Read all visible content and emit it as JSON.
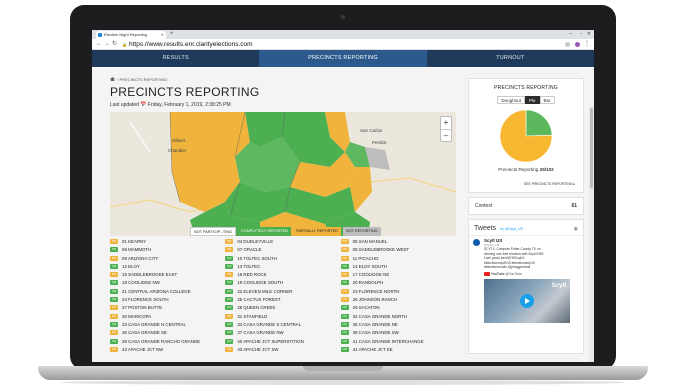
{
  "browser": {
    "tab_title": "Election Night Reporting",
    "url": "https://www.results.enr.clarityelections.com"
  },
  "nav": {
    "tabs": [
      {
        "label": "RESULTS"
      },
      {
        "label": "PRECINCTS REPORTING"
      },
      {
        "label": "TURNOUT"
      }
    ]
  },
  "breadcrumb": {
    "label": "PRECINCTS REPORTING"
  },
  "page": {
    "title": "PRECINCTS REPORTING",
    "updated": "Last updated 📅 Friday, February 1, 2019, 2:38:25 PM"
  },
  "map": {
    "place_labels": [
      "Gilbert",
      "Chandler",
      "San Carlos",
      "Peridot"
    ],
    "legend": [
      {
        "label": "NOT PARTICIP...TING",
        "color": "#ffffff"
      },
      {
        "label": "COMPLETELY REPORTED",
        "color": "#4caf50"
      },
      {
        "label": "PARTIALLY REPORTED",
        "color": "#f0b43c"
      },
      {
        "label": "NOT REPORTING",
        "color": "#bdbdbd"
      }
    ]
  },
  "precincts": [
    [
      "01 KEARNY",
      "04 DUDLEYVILLE",
      "05 SAN MANUEL"
    ],
    [
      "06 MAMMOTH",
      "07 ORACLE",
      "08 SADDLEBROOKE WEST"
    ],
    [
      "09 ARIZONA CITY",
      "10 TOLTEC SOUTH",
      "11 PICACHO"
    ],
    [
      "12 ELOY",
      "13 TOLTEC",
      "14 ELOY SOUTH"
    ],
    [
      "15 SADDLEBROOKE EAST",
      "16 RED ROCK",
      "17 COOLIDGE NE"
    ],
    [
      "18 COOLIDGE NW",
      "19 COOLIDGE SOUTH",
      "20 RANDOLPH"
    ],
    [
      "21 CENTRAL ARIZONA COLLEGE",
      "22 ELEVEN MILE CORNER",
      "23 FLORENCE NORTH"
    ],
    [
      "24 FLORENCE SOUTH",
      "25 CACTUS FOREST",
      "26 JOHNSON RANCH"
    ],
    [
      "27 POSTON BUTTE",
      "28 QUEEN CREEK",
      "29 SACATON"
    ],
    [
      "30 MARICOPA",
      "31 STANFIELD",
      "32 CASA GRANDE NORTH"
    ],
    [
      "33 CASA GRANDE N CENTRAL",
      "34 CASA GRANDE S CENTRAL",
      "35 CASA GRANDE NE"
    ],
    [
      "36 CASA GRANDE SE",
      "37 CASA GRANDE NW",
      "38 CASA GRANDE SW"
    ],
    [
      "39 CASA GRANDE RANCHO GRANDE",
      "40 APACHE JCT SUPERSTITION",
      "41 CASA GRANDE INTERCHANGE"
    ],
    [
      "42 APACHE JCT NW",
      "43 APACHE JCT SW",
      "44 APACHE JCT SE"
    ]
  ],
  "precinct_status": [
    [
      "partial",
      "partial",
      "partial"
    ],
    [
      "complete",
      "partial",
      "partial"
    ],
    [
      "partial",
      "complete",
      "partial"
    ],
    [
      "complete",
      "complete",
      "complete"
    ],
    [
      "partial",
      "partial",
      "partial"
    ],
    [
      "complete",
      "complete",
      "complete"
    ],
    [
      "complete",
      "complete",
      "partial"
    ],
    [
      "complete",
      "complete",
      "partial"
    ],
    [
      "partial",
      "complete",
      "complete"
    ],
    [
      "partial",
      "partial",
      "complete"
    ],
    [
      "complete",
      "complete",
      "complete"
    ],
    [
      "partial",
      "complete",
      "complete"
    ],
    [
      "complete",
      "complete",
      "complete"
    ],
    [
      "partial",
      "partial",
      "complete"
    ]
  ],
  "sidebar": {
    "title": "PRECINCTS REPORTING",
    "chart_toggle": [
      "Doughnut",
      "Pie",
      "Bar"
    ],
    "active_toggle": "Pie",
    "caption_prefix": "Precincts Reporting",
    "caption_value": "25/102",
    "toc_link": "SEE PRECINCTS REPORTING ▸",
    "contest_label": "Contest",
    "contest_value": "61"
  },
  "chart_data": {
    "type": "pie",
    "categories": [
      "Reporting",
      "Not reporting"
    ],
    "values": [
      25,
      77
    ],
    "colors": [
      "#5cb85c",
      "#f7b731"
    ]
  },
  "tweets": {
    "title": "Tweets",
    "by": "by @Scytl_US",
    "author": "Scytl US",
    "handle": "@Scytl_US",
    "lines": [
      "SCYTL: Compute Potter County TX on",
      "winning one-free election with Scytl ENR.",
      "Live! youtu.be/x9jYHDLqKC",
      "#electionsmp2019 #electionsmp19",
      "#electionresults @pheggenlund"
    ],
    "yt_label": "YouTube",
    "yt_handle": "@YouTube",
    "video_logo": "Scytl"
  },
  "colors": {
    "nav_bg": "#1f3a5a",
    "nav_active": "#2c5a8c",
    "complete": "#4caf50",
    "partial": "#f0b43c",
    "not_reporting": "#bdbdbd"
  }
}
